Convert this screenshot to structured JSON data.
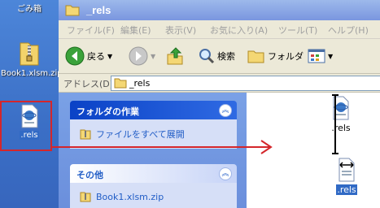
{
  "desktop": {
    "recycle_bin_label": "ごみ箱",
    "zip_label": "Book1.xlsm.zip",
    "rels_label": ".rels"
  },
  "window": {
    "title": "_rels",
    "menu": [
      "ファイル(F)",
      "編集(E)",
      "表示(V)",
      "お気に入り(A)",
      "ツール(T)",
      "ヘルプ(H)"
    ],
    "toolbar": {
      "back_label": "戻る",
      "search_label": "検索",
      "folders_label": "フォルダ"
    },
    "address": {
      "label": "アドレス(D)",
      "value": "_rels"
    }
  },
  "tasks": {
    "folder_tasks_title": "フォルダの作業",
    "extract_all_label": "ファイルをすべて展開",
    "other_title": "その他",
    "other_item_label": "Book1.xlsm.zip"
  },
  "files": {
    "rels_top": ".rels",
    "rels_dragging": ".rels"
  },
  "colors": {
    "annotation_red": "#d4262b",
    "selection_blue": "#316ac5"
  }
}
